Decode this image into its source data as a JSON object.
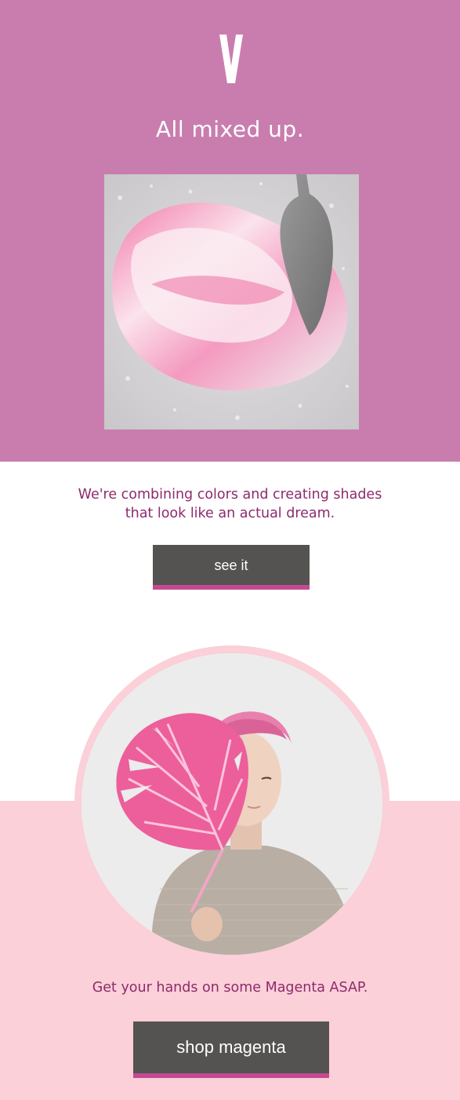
{
  "brand": {
    "logo_letter": "V",
    "accent_color": "#c97daf",
    "text_color": "#8e2a6c",
    "button_color": "#545351",
    "button_underline_color": "#c44b93",
    "band_color": "#fbd0d8"
  },
  "hero": {
    "title": "All mixed up.",
    "image_icon": "pink-paint-palette-knife-image"
  },
  "intro": {
    "text_line1": "We're combining colors and creating shades",
    "text_line2": "that look like an actual dream.",
    "button_label": "see it"
  },
  "feature": {
    "image_icon": "pink-haired-man-with-monstera-leaf-photo",
    "cta_text": "Get your hands on some Magenta ASAP.",
    "button_label": "shop magenta"
  }
}
